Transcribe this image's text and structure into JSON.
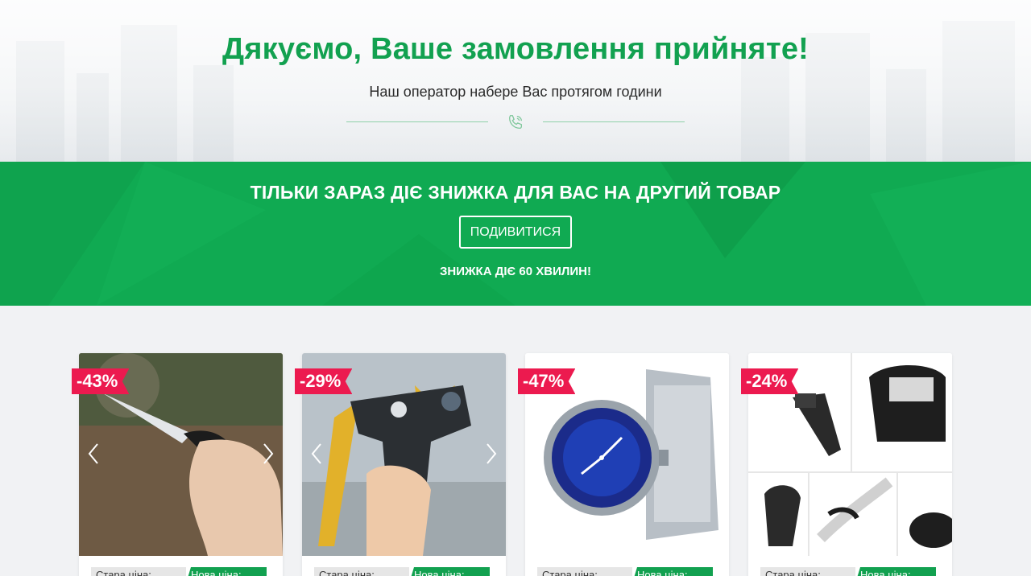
{
  "hero": {
    "title": "Дякуємо, Ваше замовлення прийняте!",
    "subtitle": "Наш оператор набере Вас протягом години",
    "icon": "phone-icon"
  },
  "promo": {
    "title": "ТІЛЬКИ ЗАРАЗ ДІЄ ЗНИЖКА ДЛЯ ВАС НА ДРУГИЙ ТОВАР",
    "button_label": "ПОДИВИТИСЯ",
    "note": "ЗНИЖКА ДІЄ 60 ХВИЛИН!"
  },
  "products": [
    {
      "discount": "-43%",
      "old_label": "Стара ціна:",
      "new_label": "Нова ціна:",
      "image": "knife"
    },
    {
      "discount": "-29%",
      "old_label": "Стара ціна:",
      "new_label": "Нова ціна:",
      "image": "slingshot"
    },
    {
      "discount": "-47%",
      "old_label": "Стара ціна:",
      "new_label": "Нова ціна:",
      "image": "watch"
    },
    {
      "discount": "-24%",
      "old_label": "Стара ціна:",
      "new_label": "Нова ціна:",
      "image": "metal-detector"
    }
  ],
  "colors": {
    "brand_green": "#12a150",
    "promo_green": "#10aa52",
    "badge_red": "#ec1a4f"
  }
}
